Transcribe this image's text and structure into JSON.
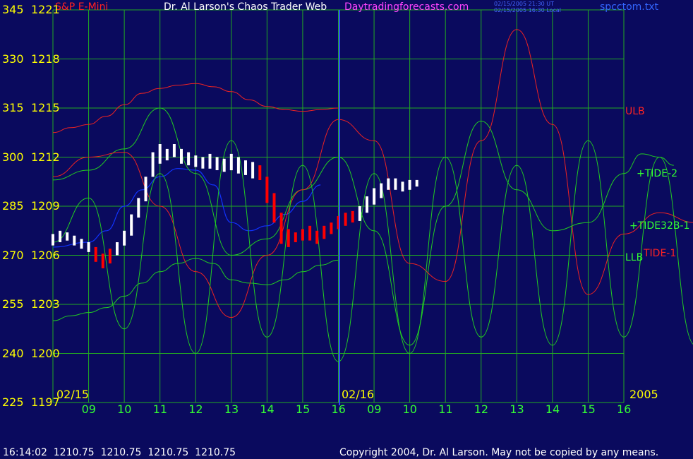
{
  "header": {
    "symbol": "S&P E-Mini",
    "title": "Dr. Al Larson's Chaos Trader Web",
    "site": "Daytradingforecasts.com",
    "timestamp_ut": "02/15/2005 21:30 UT",
    "timestamp_local": "02/15/2005 16:30 Local",
    "filename": "spcctom.txt"
  },
  "footer": {
    "quote": "16:14:02  1210.75  1210.75  1210.75  1210.75",
    "copyright": "Copyright 2004, Dr. Al Larson. May not be copied by any means."
  },
  "colors": {
    "background": "#0a0a5e",
    "grid": "#22aa22",
    "price_up": "#ffffff",
    "price_down": "#ff0000",
    "band": "#ee2222",
    "tide": "#22cc22",
    "avg": "#1133ff",
    "axis_label": "#ffff00",
    "time_label": "#33ff33",
    "site": "#ff44ff",
    "filename": "#3366ff"
  },
  "chart_data": {
    "type": "line",
    "left_axis_labels": [
      "345",
      "330",
      "315",
      "300",
      "285",
      "270",
      "255",
      "240",
      "225"
    ],
    "price_axis_labels": [
      "1221",
      "1218",
      "1215",
      "1212",
      "1209",
      "1206",
      "1203",
      "1200",
      "1197"
    ],
    "price_range": [
      1197,
      1221
    ],
    "hour_labels": [
      "09",
      "10",
      "11",
      "12",
      "13",
      "14",
      "15",
      "16",
      "09",
      "10",
      "11",
      "12",
      "13",
      "14",
      "15",
      "16"
    ],
    "date_labels": [
      "02/15",
      "02/16"
    ],
    "year_label": "2005",
    "line_labels": {
      "ulb": "ULB",
      "tide2": "+TIDE-2",
      "tide32b1": "+TIDE32B-1",
      "llb": "LLB",
      "tide1": "TIDE-1"
    },
    "series": [
      {
        "name": "ULB",
        "color": "red",
        "points": [
          [
            0,
            1213.5
          ],
          [
            0.5,
            1213.8
          ],
          [
            1,
            1214
          ],
          [
            1.5,
            1214.5
          ],
          [
            2,
            1215.2
          ],
          [
            2.5,
            1215.9
          ],
          [
            3,
            1216.2
          ],
          [
            3.5,
            1216.4
          ],
          [
            4,
            1216.5
          ],
          [
            4.5,
            1216.3
          ],
          [
            5,
            1216
          ],
          [
            5.5,
            1215.5
          ],
          [
            6,
            1215.1
          ],
          [
            6.5,
            1214.9
          ],
          [
            7,
            1214.8
          ],
          [
            7.5,
            1214.9
          ],
          [
            8,
            1215
          ]
        ]
      },
      {
        "name": "LLB",
        "color": "green",
        "points": [
          [
            0,
            1202
          ],
          [
            0.5,
            1202.3
          ],
          [
            1,
            1202.5
          ],
          [
            1.5,
            1202.8
          ],
          [
            2,
            1203.5
          ],
          [
            2.5,
            1204.3
          ],
          [
            3,
            1205
          ],
          [
            3.5,
            1205.5
          ],
          [
            4,
            1205.8
          ],
          [
            4.5,
            1205.5
          ],
          [
            5,
            1204.5
          ],
          [
            5.5,
            1204.3
          ],
          [
            6,
            1204.2
          ],
          [
            6.5,
            1204.5
          ],
          [
            7,
            1205
          ],
          [
            7.5,
            1205.4
          ],
          [
            8,
            1205.7
          ]
        ]
      },
      {
        "name": "Average",
        "color": "blue",
        "points": [
          [
            0,
            1206.5
          ],
          [
            1,
            1206.8
          ],
          [
            1.5,
            1207.5
          ],
          [
            2,
            1209
          ],
          [
            2.5,
            1210
          ],
          [
            3,
            1210.8
          ],
          [
            3.5,
            1211.3
          ],
          [
            4,
            1211.2
          ],
          [
            4.5,
            1210.3
          ],
          [
            5,
            1208
          ],
          [
            5.5,
            1207.5
          ],
          [
            6,
            1207.8
          ],
          [
            6.5,
            1208.5
          ],
          [
            7,
            1209.3
          ],
          [
            7.5,
            1210.3
          ]
        ]
      },
      {
        "name": "+TIDE-2",
        "color": "green",
        "points": [
          [
            0,
            1210.6
          ],
          [
            1,
            1211.2
          ],
          [
            2,
            1212.5
          ],
          [
            3,
            1215
          ],
          [
            4,
            1211
          ],
          [
            5,
            1206
          ],
          [
            6,
            1207
          ],
          [
            7,
            1210
          ],
          [
            8,
            1212
          ],
          [
            9,
            1207.5
          ],
          [
            10,
            1200.5
          ],
          [
            11,
            1209
          ],
          [
            12,
            1214.2
          ],
          [
            13,
            1210
          ],
          [
            14,
            1207.5
          ],
          [
            15,
            1208
          ],
          [
            16,
            1211
          ],
          [
            16.5,
            1212.2
          ],
          [
            17,
            1212
          ],
          [
            17.4,
            1211.5
          ]
        ]
      },
      {
        "name": "TIDE-1",
        "color": "red",
        "points": [
          [
            0,
            1210.8
          ],
          [
            1,
            1212
          ],
          [
            2,
            1212.3
          ],
          [
            3,
            1209
          ],
          [
            4,
            1205
          ],
          [
            5,
            1202.2
          ],
          [
            6,
            1206
          ],
          [
            7,
            1210
          ],
          [
            8,
            1214.3
          ],
          [
            9,
            1213
          ],
          [
            10,
            1205.5
          ],
          [
            11,
            1204.4
          ],
          [
            12,
            1213
          ],
          [
            13,
            1219.8
          ],
          [
            14,
            1214
          ],
          [
            15,
            1203.6
          ],
          [
            16,
            1207.3
          ],
          [
            17,
            1208.6
          ],
          [
            18,
            1208
          ],
          [
            19,
            1207
          ],
          [
            19.3,
            1205.8
          ],
          [
            19.7,
            1205.4
          ]
        ]
      },
      {
        "name": "+TIDE32B-1",
        "color": "green",
        "points": [
          [
            0,
            1206.8
          ],
          [
            1,
            1209.5
          ],
          [
            2,
            1201.5
          ],
          [
            3,
            1211
          ],
          [
            4,
            1200
          ],
          [
            5,
            1213
          ],
          [
            6,
            1201
          ],
          [
            7,
            1211.5
          ],
          [
            8,
            1199.5
          ],
          [
            9,
            1211
          ],
          [
            10,
            1200
          ],
          [
            11,
            1212
          ],
          [
            12,
            1201
          ],
          [
            13,
            1211.5
          ],
          [
            14,
            1200.5
          ],
          [
            15,
            1213
          ],
          [
            16,
            1201
          ],
          [
            17,
            1212
          ],
          [
            18,
            1200.5
          ],
          [
            19,
            1211.5
          ],
          [
            19.7,
            1204
          ]
        ]
      }
    ],
    "price_bars": [
      [
        0.0,
        1207.3,
        1206.6,
        1
      ],
      [
        0.2,
        1207.5,
        1206.8,
        1
      ],
      [
        0.4,
        1207.4,
        1206.9,
        1
      ],
      [
        0.6,
        1207.2,
        1206.6,
        1
      ],
      [
        0.8,
        1207.0,
        1206.4,
        1
      ],
      [
        1.0,
        1206.8,
        1206.2,
        1
      ],
      [
        1.2,
        1206.5,
        1205.6,
        0
      ],
      [
        1.4,
        1206.1,
        1205.2,
        0
      ],
      [
        1.6,
        1206.4,
        1205.5,
        0
      ],
      [
        1.8,
        1206.8,
        1206.0,
        1
      ],
      [
        2.0,
        1207.5,
        1206.6,
        1
      ],
      [
        2.2,
        1208.5,
        1207.2,
        1
      ],
      [
        2.4,
        1209.5,
        1208.3,
        1
      ],
      [
        2.6,
        1210.8,
        1209.3,
        1
      ],
      [
        2.8,
        1212.3,
        1210.8,
        1
      ],
      [
        3.0,
        1212.8,
        1211.6,
        1
      ],
      [
        3.2,
        1212.5,
        1211.8,
        1
      ],
      [
        3.4,
        1212.8,
        1212.0,
        1
      ],
      [
        3.6,
        1212.5,
        1211.6,
        1
      ],
      [
        3.8,
        1212.3,
        1211.5,
        1
      ],
      [
        4.0,
        1212.1,
        1211.4,
        1
      ],
      [
        4.2,
        1212.0,
        1211.3,
        1
      ],
      [
        4.4,
        1212.2,
        1211.3,
        1
      ],
      [
        4.6,
        1212.0,
        1211.2,
        1
      ],
      [
        4.8,
        1211.9,
        1211.1,
        1
      ],
      [
        5.0,
        1212.2,
        1211.2,
        1
      ],
      [
        5.2,
        1212.0,
        1211.0,
        1
      ],
      [
        5.4,
        1211.8,
        1210.9,
        1
      ],
      [
        5.6,
        1211.7,
        1210.7,
        1
      ],
      [
        5.8,
        1211.5,
        1210.6,
        0
      ],
      [
        6.0,
        1210.8,
        1209.2,
        0
      ],
      [
        6.2,
        1209.8,
        1208.0,
        0
      ],
      [
        6.4,
        1208.6,
        1206.7,
        0
      ],
      [
        6.6,
        1207.6,
        1206.5,
        0
      ],
      [
        6.8,
        1207.4,
        1206.8,
        0
      ],
      [
        7.0,
        1207.6,
        1206.9,
        0
      ],
      [
        7.2,
        1207.8,
        1206.9,
        0
      ],
      [
        7.4,
        1207.5,
        1206.7,
        0
      ],
      [
        7.6,
        1207.8,
        1207.0,
        0
      ],
      [
        7.8,
        1208.0,
        1207.3,
        0
      ],
      [
        8.0,
        1208.4,
        1207.6,
        0
      ],
      [
        8.2,
        1208.6,
        1207.8,
        0
      ],
      [
        8.4,
        1208.7,
        1208.0,
        0
      ],
      [
        8.6,
        1209.0,
        1208.1,
        1
      ],
      [
        8.8,
        1209.6,
        1208.6,
        1
      ],
      [
        9.0,
        1210.1,
        1209.1,
        1
      ],
      [
        9.2,
        1210.4,
        1209.5,
        1
      ],
      [
        9.4,
        1210.7,
        1210.0,
        1
      ],
      [
        9.6,
        1210.7,
        1210.0,
        1
      ],
      [
        9.8,
        1210.5,
        1209.9,
        1
      ],
      [
        10.0,
        1210.6,
        1210.0,
        1
      ],
      [
        10.2,
        1210.6,
        1210.2,
        1
      ]
    ]
  }
}
